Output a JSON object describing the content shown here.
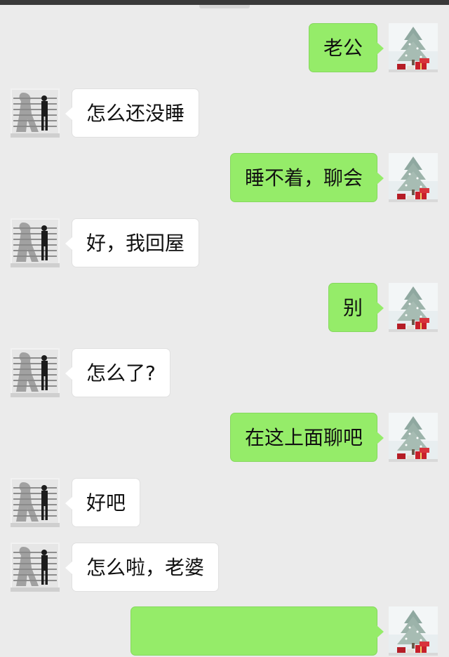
{
  "messages": [
    {
      "side": "out",
      "text": "老公"
    },
    {
      "side": "in",
      "text": "怎么还没睡"
    },
    {
      "side": "out",
      "text": "睡不着，聊会"
    },
    {
      "side": "in",
      "text": "好，我回屋"
    },
    {
      "side": "out",
      "text": "别"
    },
    {
      "side": "in",
      "text": "怎么了?"
    },
    {
      "side": "out",
      "text": "在这上面聊吧"
    },
    {
      "side": "in",
      "text": "好吧"
    },
    {
      "side": "in",
      "text": "怎么啦，老婆"
    },
    {
      "side": "out",
      "text": ""
    }
  ],
  "avatars": {
    "self": "christmas-tree-avatar",
    "contact": "walking-man-shadow-avatar"
  },
  "colors": {
    "background": "#ebebeb",
    "outgoing_bubble": "#95ec69",
    "incoming_bubble": "#ffffff"
  }
}
